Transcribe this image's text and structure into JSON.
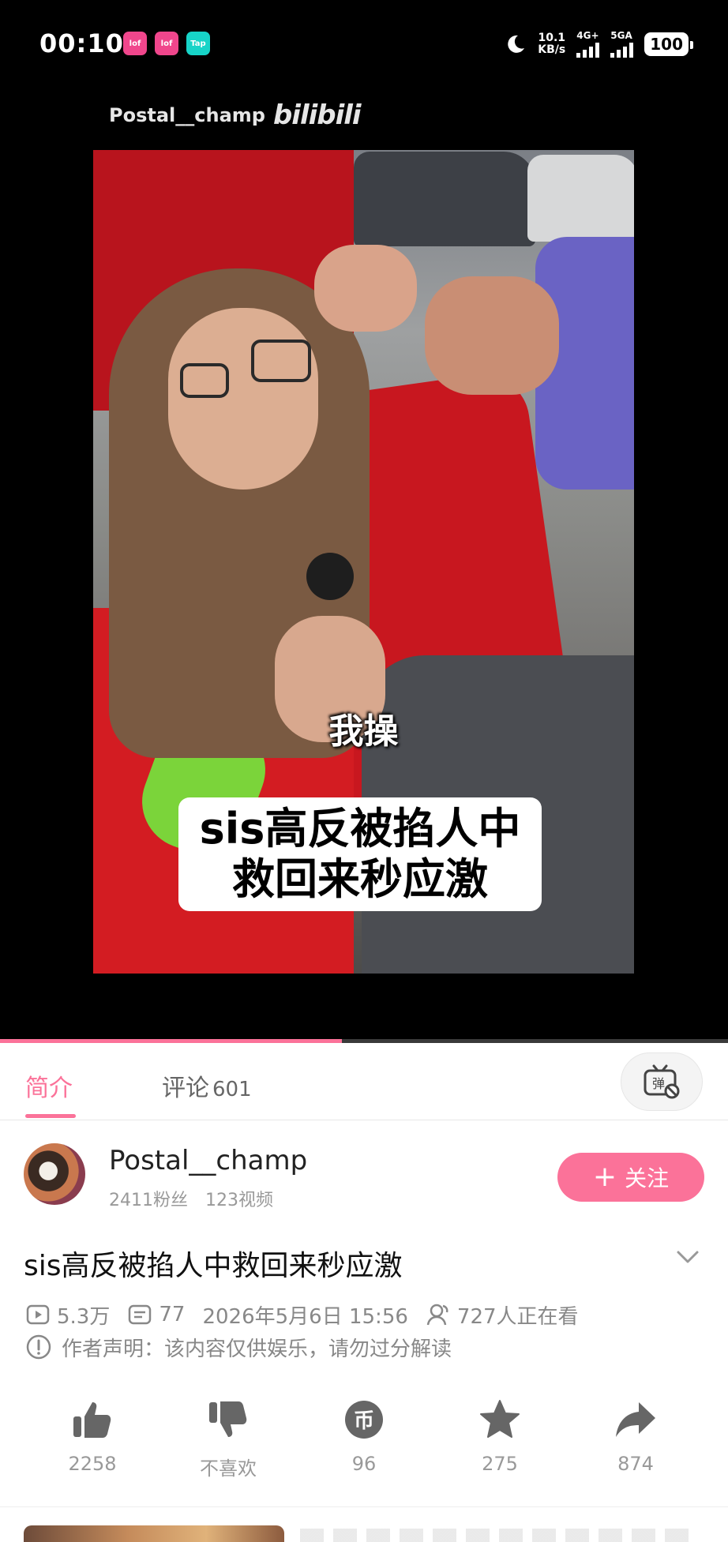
{
  "status_bar": {
    "time": "00:10",
    "app_badges": [
      {
        "label": "lofter",
        "color": "#f0468c"
      },
      {
        "label": "lofter",
        "color": "#f0468c"
      },
      {
        "label": "Tap",
        "color": "#17d4c8"
      }
    ],
    "net_speed_value": "10.1",
    "net_speed_unit": "KB/s",
    "signal1_label": "4G+",
    "signal2_label": "5GA",
    "battery": "100"
  },
  "video": {
    "watermark_user": "Postal__champ",
    "watermark_logo": "bilibili",
    "subtitle_small": "我操",
    "subtitle_box_line1": "sis高反被掐人中",
    "subtitle_box_line2": "救回来秒应激",
    "progress": 0.47,
    "accent_color": "#fb7299"
  },
  "tabs": {
    "intro": "简介",
    "comments": "评论",
    "comments_count": "601",
    "danmaku_icon": "danmaku-toggle-icon"
  },
  "uploader": {
    "name": "Postal__champ",
    "fans": "2411粉丝",
    "videos": "123视频",
    "follow_plus": "+",
    "follow_label": "关注"
  },
  "info": {
    "title": "sis高反被掐人中救回来秒应激",
    "views": "5.3万",
    "danmaku_count": "77",
    "date": "2026年5月6日 15:56",
    "watching": "727人正在看",
    "declaration": "作者声明：该内容仅供娱乐，请勿过分解读"
  },
  "actions": {
    "like": "2258",
    "dislike": "不喜欢",
    "coin": "96",
    "favorite": "275",
    "share": "874"
  }
}
